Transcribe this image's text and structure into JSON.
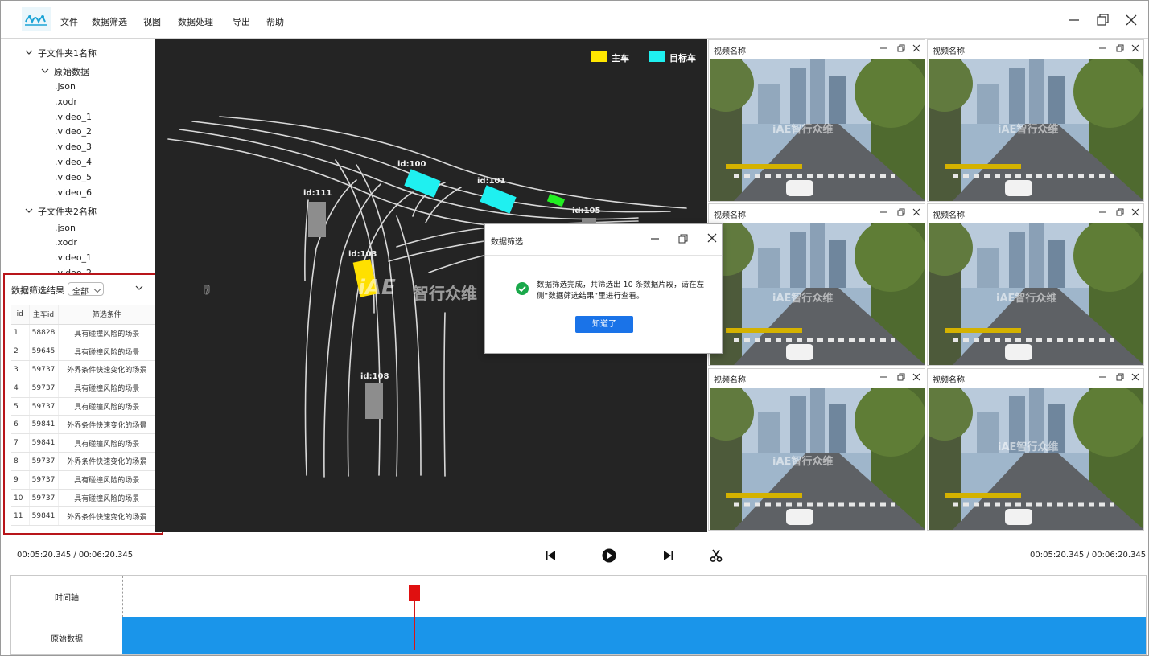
{
  "menu": {
    "items": [
      "文件",
      "数据筛选",
      "视图",
      "数据处理",
      "导出",
      "帮助"
    ]
  },
  "tree": {
    "folder1": {
      "label": "子文件夹1名称",
      "subfolder": "原始数据",
      "files": [
        ".json",
        ".xodr",
        ".video_1",
        ".video_2",
        ".video_3",
        ".video_4",
        ".video_5",
        ".video_6"
      ]
    },
    "folder2": {
      "label": "子文件夹2名称",
      "files": [
        ".json",
        ".xodr",
        ".video_1",
        ".video_2"
      ]
    }
  },
  "results": {
    "title": "数据筛选结果",
    "filter_value": "全部",
    "columns": [
      "id",
      "主车id",
      "筛选条件"
    ],
    "rows": [
      {
        "id": "1",
        "car": "58828",
        "cond": "具有碰撞风险的场景"
      },
      {
        "id": "2",
        "car": "59645",
        "cond": "具有碰撞风险的场景"
      },
      {
        "id": "3",
        "car": "59737",
        "cond": "外界条件快速变化的场景"
      },
      {
        "id": "4",
        "car": "59737",
        "cond": "具有碰撞风险的场景"
      },
      {
        "id": "5",
        "car": "59737",
        "cond": "具有碰撞风险的场景"
      },
      {
        "id": "6",
        "car": "59841",
        "cond": "外界条件快速变化的场景"
      },
      {
        "id": "7",
        "car": "59841",
        "cond": "具有碰撞风险的场景"
      },
      {
        "id": "8",
        "car": "59737",
        "cond": "外界条件快速变化的场景"
      },
      {
        "id": "9",
        "car": "59737",
        "cond": "具有碰撞风险的场景"
      },
      {
        "id": "10",
        "car": "59737",
        "cond": "具有碰撞风险的场景"
      },
      {
        "id": "11",
        "car": "59841",
        "cond": "外界条件快速变化的场景"
      }
    ]
  },
  "map": {
    "legend": [
      {
        "label": "主车",
        "color": "#ffe600"
      },
      {
        "label": "目标车",
        "color": "#1ff0f0"
      }
    ],
    "cars": [
      "id:100",
      "id:101",
      "id:105",
      "id:111",
      "id:103",
      "id:108"
    ],
    "watermark_logo": "iAE",
    "watermark_text": "智行众维"
  },
  "dialog": {
    "title": "数据筛选",
    "message": "数据筛选完成，共筛选出 10 条数据片段，请在左侧“数据筛选结果”里进行查看。",
    "ok_label": "知道了"
  },
  "videos": {
    "titles": [
      "视频名称",
      "视频名称",
      "视频名称",
      "视频名称",
      "视频名称",
      "视频名称"
    ],
    "watermark": "iAE智行众维"
  },
  "playback": {
    "time_left": "00:05:20.345 / 00:06:20.345",
    "time_right": "00:05:20.345 / 00:06:20.345"
  },
  "timeline": {
    "track_axis": "时间轴",
    "track_data": "原始数据",
    "playhead_fraction": 0.285
  },
  "colors": {
    "accent": "#1a73e8",
    "success": "#19a84a",
    "highlight_border": "#b8151a",
    "timeline_fill": "#1a95ea",
    "playhead": "#e01010"
  }
}
